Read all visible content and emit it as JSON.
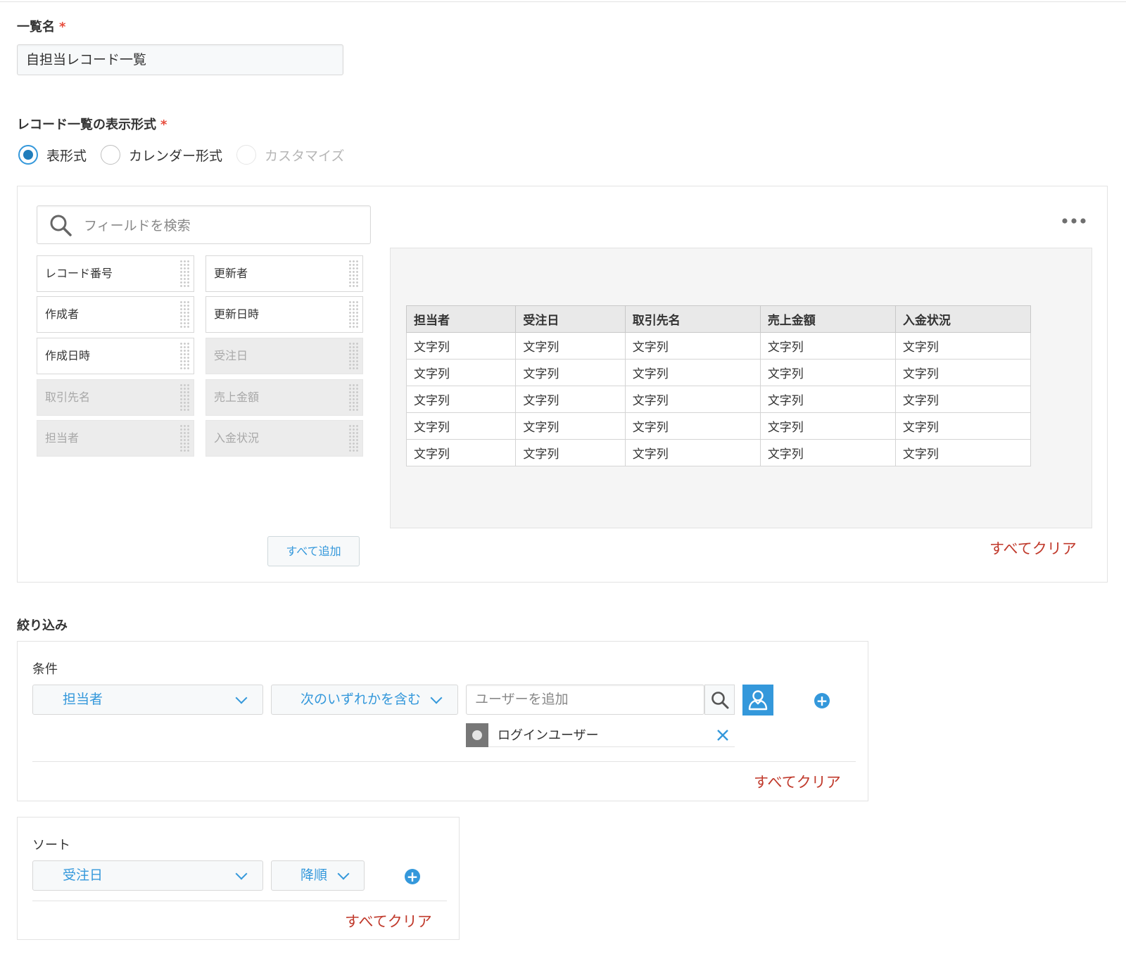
{
  "list_name": {
    "label": "一覧名",
    "required_mark": "*",
    "value": "自担当レコード一覧"
  },
  "display_format": {
    "label": "レコード一覧の表示形式",
    "required_mark": "*",
    "options": [
      {
        "label": "表形式",
        "checked": true,
        "disabled": false
      },
      {
        "label": "カレンダー形式",
        "checked": false,
        "disabled": false
      },
      {
        "label": "カスタマイズ",
        "checked": false,
        "disabled": true
      }
    ]
  },
  "field_picker": {
    "search_placeholder": "フィールドを検索",
    "fields": [
      {
        "label": "レコード番号",
        "used": false
      },
      {
        "label": "更新者",
        "used": false
      },
      {
        "label": "作成者",
        "used": false
      },
      {
        "label": "更新日時",
        "used": false
      },
      {
        "label": "作成日時",
        "used": false
      },
      {
        "label": "受注日",
        "used": true
      },
      {
        "label": "取引先名",
        "used": true
      },
      {
        "label": "売上金額",
        "used": true
      },
      {
        "label": "担当者",
        "used": true
      },
      {
        "label": "入金状況",
        "used": true
      }
    ],
    "add_all_label": "すべて追加",
    "more_icon": "more-dots-icon"
  },
  "preview_table": {
    "columns": [
      "担当者",
      "受注日",
      "取引先名",
      "売上金額",
      "入金状況"
    ],
    "rows": [
      [
        "文字列",
        "文字列",
        "文字列",
        "文字列",
        "文字列"
      ],
      [
        "文字列",
        "文字列",
        "文字列",
        "文字列",
        "文字列"
      ],
      [
        "文字列",
        "文字列",
        "文字列",
        "文字列",
        "文字列"
      ],
      [
        "文字列",
        "文字列",
        "文字列",
        "文字列",
        "文字列"
      ],
      [
        "文字列",
        "文字列",
        "文字列",
        "文字列",
        "文字列"
      ]
    ],
    "clear_all_label": "すべてクリア"
  },
  "filter": {
    "section_label": "絞り込み",
    "condition_label": "条件",
    "field_select": "担当者",
    "operator_select": "次のいずれかを含む",
    "user_input_placeholder": "ユーザーを追加",
    "selected_user": "ログインユーザー",
    "clear_all_label": "すべてクリア"
  },
  "sort": {
    "label": "ソート",
    "field_select": "受注日",
    "order_select": "降順",
    "clear_all_label": "すべてクリア"
  },
  "colors": {
    "accent": "#3498db",
    "danger": "#c0392b",
    "required": "#e74c3c"
  }
}
